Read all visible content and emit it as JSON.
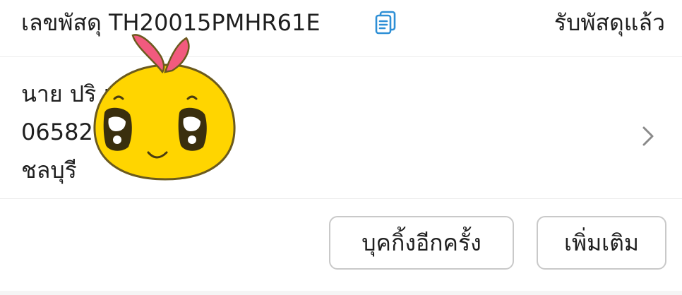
{
  "header": {
    "tracking_label": "เลขพัสดุ TH20015PMHR61E",
    "status": "รับพัสดุแล้ว"
  },
  "address": {
    "name": "นาย ปริ        แซง",
    "phone": "06582",
    "province": "ชลบุรี"
  },
  "actions": {
    "rebook_label": "บุคกิ้งอีกครั้ง",
    "more_label": "เพิ่มเติม"
  },
  "colors": {
    "accent_blue": "#2e8fd6",
    "sticker_yellow": "#ffd500",
    "sticker_pink": "#f25a7e"
  },
  "icons": {
    "copy": "copy-icon",
    "chevron": "chevron-right-icon",
    "sticker": "cute-chick-sticker"
  }
}
